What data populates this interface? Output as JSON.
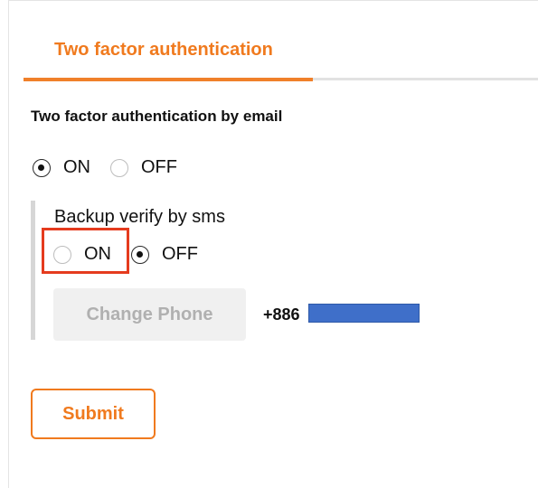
{
  "tab": {
    "title": "Two factor authentication"
  },
  "email_2fa": {
    "label": "Two factor authentication by email",
    "options": [
      {
        "label": "ON",
        "checked": true
      },
      {
        "label": "OFF",
        "checked": false
      }
    ]
  },
  "sms_backup": {
    "label": "Backup verify by sms",
    "options": [
      {
        "label": "ON",
        "checked": false
      },
      {
        "label": "OFF",
        "checked": true
      }
    ],
    "change_phone_label": "Change Phone",
    "phone_prefix": "+886"
  },
  "submit_label": "Submit",
  "colors": {
    "accent": "#f07a1e",
    "highlight": "#e53b1e",
    "redaction": "#3f6fc9"
  }
}
